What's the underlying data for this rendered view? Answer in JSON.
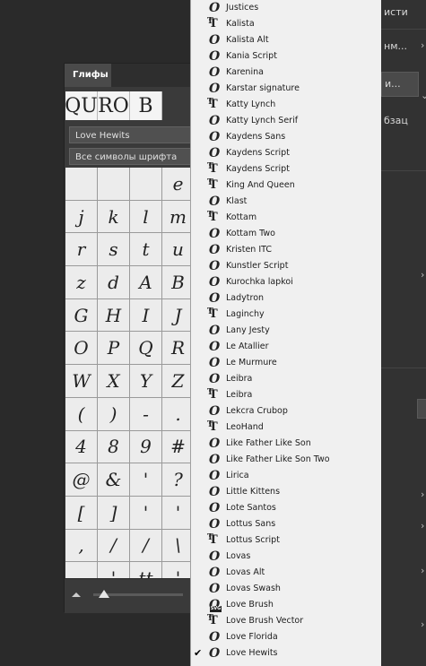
{
  "right_panel": {
    "top_text": "исти",
    "second_text": "нм...",
    "button_text": "и...",
    "paragraph_text": "бзац"
  },
  "glyph_panel": {
    "title": "Глифы",
    "recent_glyphs": [
      "Q",
      "U",
      "R",
      "O",
      "B"
    ],
    "font_value": "Love Hewits",
    "category_value": "Все символы шрифта",
    "grid": [
      [
        "",
        "",
        "",
        "e"
      ],
      [
        "j",
        "k",
        "l",
        "m"
      ],
      [
        "r",
        "s",
        "t",
        "u"
      ],
      [
        "z",
        "d",
        "A",
        "B"
      ],
      [
        "G",
        "H",
        "I",
        "J"
      ],
      [
        "O",
        "P",
        "Q",
        "R"
      ],
      [
        "W",
        "X",
        "Y",
        "Z"
      ],
      [
        "(",
        ")",
        "-",
        "."
      ],
      [
        "4",
        "8",
        "9",
        "#"
      ],
      [
        "@",
        "&",
        "'",
        "?"
      ],
      [
        "[",
        "]",
        "'",
        "'"
      ],
      [
        ",",
        "/",
        "/",
        "\\"
      ],
      [
        ".",
        "'",
        "tt",
        "'"
      ]
    ]
  },
  "font_menu": {
    "items": [
      {
        "name": "Justices",
        "type": "opentype",
        "checked": false
      },
      {
        "name": "Kalista",
        "type": "truetype",
        "checked": false
      },
      {
        "name": "Kalista Alt",
        "type": "opentype",
        "checked": false
      },
      {
        "name": "Kania Script",
        "type": "opentype",
        "checked": false
      },
      {
        "name": "Karenina",
        "type": "opentype",
        "checked": false
      },
      {
        "name": "Karstar signature",
        "type": "opentype",
        "checked": false
      },
      {
        "name": "Katty Lynch",
        "type": "truetype",
        "checked": false
      },
      {
        "name": "Katty Lynch Serif",
        "type": "opentype",
        "checked": false
      },
      {
        "name": "Kaydens Sans",
        "type": "opentype",
        "checked": false
      },
      {
        "name": "Kaydens Script",
        "type": "opentype",
        "checked": false
      },
      {
        "name": "Kaydens Script",
        "type": "truetype",
        "checked": false
      },
      {
        "name": "King And Queen",
        "type": "truetype",
        "checked": false
      },
      {
        "name": "Klast",
        "type": "opentype",
        "checked": false
      },
      {
        "name": "Kottam",
        "type": "truetype",
        "checked": false
      },
      {
        "name": "Kottam Two",
        "type": "opentype",
        "checked": false
      },
      {
        "name": "Kristen ITC",
        "type": "opentype",
        "checked": false
      },
      {
        "name": "Kunstler Script",
        "type": "opentype",
        "checked": false
      },
      {
        "name": "Kurochka lapkoi",
        "type": "opentype",
        "checked": false
      },
      {
        "name": "Ladytron",
        "type": "opentype",
        "checked": false
      },
      {
        "name": "Laginchy",
        "type": "truetype",
        "checked": false
      },
      {
        "name": "Lany Jesty",
        "type": "opentype",
        "checked": false
      },
      {
        "name": "Le Atallier",
        "type": "opentype",
        "checked": false
      },
      {
        "name": "Le Murmure",
        "type": "opentype",
        "checked": false
      },
      {
        "name": "Leibra",
        "type": "opentype",
        "checked": false
      },
      {
        "name": "Leibra",
        "type": "truetype",
        "checked": false
      },
      {
        "name": "Lekcra Crubop",
        "type": "opentype",
        "checked": false
      },
      {
        "name": "LeoHand",
        "type": "truetype",
        "checked": false
      },
      {
        "name": "Like Father Like Son",
        "type": "opentype",
        "checked": false
      },
      {
        "name": "Like Father Like Son Two",
        "type": "opentype",
        "checked": false
      },
      {
        "name": "Lirica",
        "type": "opentype",
        "checked": false
      },
      {
        "name": "Little Kittens",
        "type": "opentype",
        "checked": false
      },
      {
        "name": "Lote Santos",
        "type": "opentype",
        "checked": false
      },
      {
        "name": "Lottus Sans",
        "type": "opentype",
        "checked": false
      },
      {
        "name": "Lottus Script",
        "type": "truetype",
        "checked": false
      },
      {
        "name": "Lovas",
        "type": "opentype",
        "checked": false
      },
      {
        "name": "Lovas Alt",
        "type": "opentype",
        "checked": false
      },
      {
        "name": "Lovas Swash",
        "type": "opentype",
        "checked": false
      },
      {
        "name": "Love Brush",
        "type": "svg",
        "checked": false
      },
      {
        "name": "Love Brush Vector",
        "type": "truetype",
        "checked": false
      },
      {
        "name": "Love Florida",
        "type": "opentype",
        "checked": false
      },
      {
        "name": "Love Hewits",
        "type": "opentype",
        "checked": true
      }
    ]
  }
}
